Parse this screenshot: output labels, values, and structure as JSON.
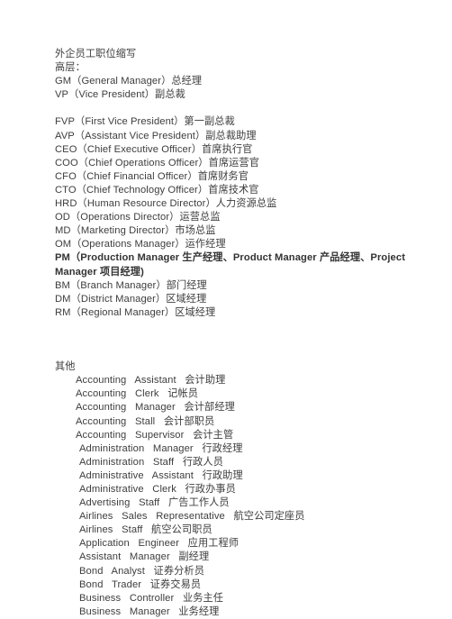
{
  "document": {
    "title_line": "外企员工职位缩写",
    "sections": [
      {
        "name": "senior-management",
        "heading": "高层：",
        "lines": [
          {
            "text": "GM（General Manager）总经理",
            "indent": 0,
            "bold": false
          },
          {
            "text": "VP（Vice President）副总裁",
            "indent": 0,
            "bold": false
          },
          {
            "text": "",
            "indent": 0,
            "bold": false
          },
          {
            "text": "FVP（First Vice President）第一副总裁",
            "indent": 0,
            "bold": false
          },
          {
            "text": "AVP（Assistant Vice President）副总裁助理",
            "indent": 0,
            "bold": false
          },
          {
            "text": "CEO（Chief Executive Officer）首席执行官",
            "indent": 0,
            "bold": false
          },
          {
            "text": "COO（Chief Operations Officer）首席运营官",
            "indent": 0,
            "bold": false
          },
          {
            "text": "CFO（Chief Financial Officer）首席财务官",
            "indent": 0,
            "bold": false
          },
          {
            "text": "CTO（Chief Technology Officer）首席技术官",
            "indent": 0,
            "bold": false
          },
          {
            "text": "HRD（Human Resource Director）人力资源总监",
            "indent": 0,
            "bold": false
          },
          {
            "text": "OD（Operations Director）运营总监",
            "indent": 0,
            "bold": false
          },
          {
            "text": "MD（Marketing Director）市场总监",
            "indent": 0,
            "bold": false
          },
          {
            "text": "OM（Operations Manager）运作经理",
            "indent": 0,
            "bold": false
          },
          {
            "text": "PM（Production Manager 生产经理、Product Manager 产品经理、Project Manager 项目经理)",
            "indent": 0,
            "bold": true
          },
          {
            "text": "BM（Branch Manager）部门经理",
            "indent": 0,
            "bold": false
          },
          {
            "text": "DM（District Manager）区域经理",
            "indent": 0,
            "bold": false
          },
          {
            "text": "RM（Regional Manager）区域经理",
            "indent": 0,
            "bold": false
          },
          {
            "text": "",
            "indent": 0,
            "bold": false
          },
          {
            "text": "",
            "indent": 0,
            "bold": false
          }
        ]
      },
      {
        "name": "others",
        "heading": "其他",
        "lines": [
          {
            "text": "Accounting   Assistant   会计助理",
            "indent": 1,
            "bold": false
          },
          {
            "text": "Accounting   Clerk   记帐员",
            "indent": 1,
            "bold": false
          },
          {
            "text": "Accounting   Manager   会计部经理",
            "indent": 1,
            "bold": false
          },
          {
            "text": "Accounting   Stall   会计部职员",
            "indent": 1,
            "bold": false
          },
          {
            "text": "Accounting   Supervisor   会计主管",
            "indent": 1,
            "bold": false
          },
          {
            "text": "Administration   Manager   行政经理",
            "indent": 2,
            "bold": false
          },
          {
            "text": "Administration   Staff   行政人员",
            "indent": 2,
            "bold": false
          },
          {
            "text": "Administrative   Assistant   行政助理",
            "indent": 2,
            "bold": false
          },
          {
            "text": "Administrative   Clerk   行政办事员",
            "indent": 2,
            "bold": false
          },
          {
            "text": "Advertising   Staff   广告工作人员",
            "indent": 2,
            "bold": false
          },
          {
            "text": "Airlines   Sales   Representative   航空公司定座员",
            "indent": 2,
            "bold": false
          },
          {
            "text": "Airlines   Staff   航空公司职员",
            "indent": 2,
            "bold": false
          },
          {
            "text": "Application   Engineer   应用工程师",
            "indent": 2,
            "bold": false
          },
          {
            "text": "Assistant   Manager   副经理",
            "indent": 2,
            "bold": false
          },
          {
            "text": "Bond   Analyst   证券分析员",
            "indent": 2,
            "bold": false
          },
          {
            "text": "Bond   Trader   证券交易员",
            "indent": 2,
            "bold": false
          },
          {
            "text": "Business   Controller   业务主任",
            "indent": 2,
            "bold": false
          },
          {
            "text": "Business   Manager   业务经理",
            "indent": 2,
            "bold": false
          }
        ]
      }
    ]
  }
}
